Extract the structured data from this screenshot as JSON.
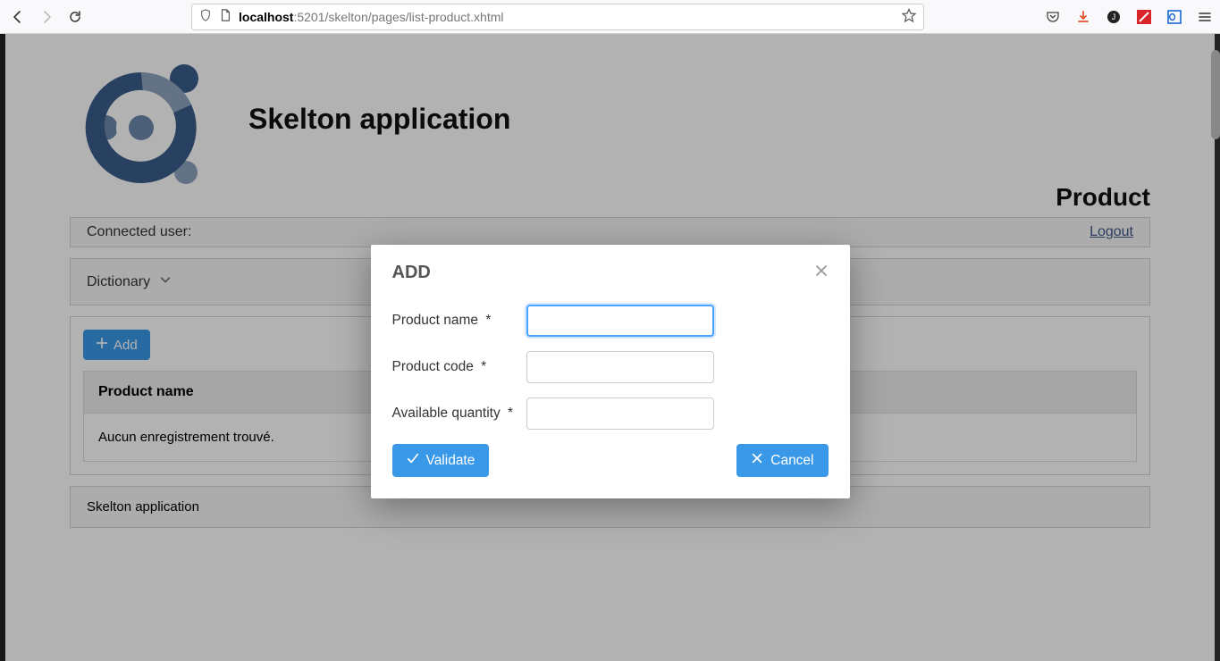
{
  "browser": {
    "url_bold": "localhost",
    "url_rest": ":5201/skelton/pages/list-product.xhtml"
  },
  "header": {
    "app_title": "Skelton application",
    "page_title": "Product"
  },
  "user_bar": {
    "label": "Connected user:",
    "logout": "Logout"
  },
  "menu": {
    "dictionary": "Dictionary"
  },
  "list": {
    "add_label": "Add",
    "column_header": "Product name",
    "empty_text": "Aucun enregistrement trouvé."
  },
  "footer": {
    "text": "Skelton application"
  },
  "dialog": {
    "title": "ADD",
    "fields": {
      "name_label": "Product name",
      "code_label": "Product code",
      "qty_label": "Available quantity",
      "required_mark": "*"
    },
    "buttons": {
      "validate": "Validate",
      "cancel": "Cancel"
    }
  }
}
